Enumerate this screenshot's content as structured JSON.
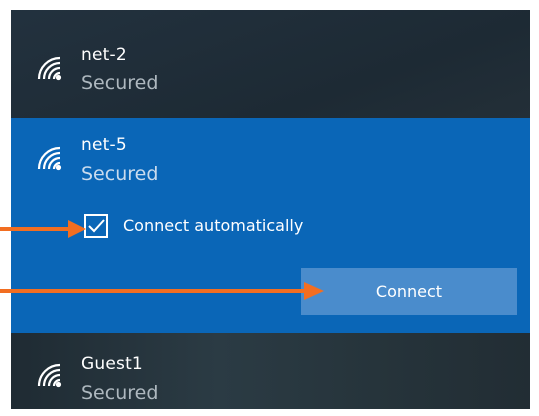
{
  "networks": [
    {
      "name": "net-2",
      "status": "Secured"
    },
    {
      "name": "net-5",
      "status": "Secured"
    },
    {
      "name": "Guest1",
      "status": "Secured"
    }
  ],
  "selected_network": {
    "connect_automatically_label": "Connect automatically",
    "connect_automatically_checked": true,
    "connect_button_label": "Connect"
  },
  "annotations": {
    "arrow_color": "#f26e21",
    "arrows": [
      "arrow-to-checkbox",
      "arrow-to-connect-button"
    ]
  },
  "colors": {
    "selected_row_bg": "#0a66b7",
    "button_bg": "#4a8ccc",
    "flyout_bg": "#1f2b35"
  }
}
